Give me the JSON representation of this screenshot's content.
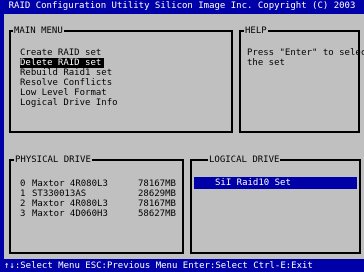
{
  "title": "RAID Configuration Utility   Silicon Image Inc. Copyright (C) 2003",
  "main_menu": {
    "title": "MAIN MENU",
    "items": [
      "Create RAID set",
      "Delete RAID set",
      "Rebuild Raid1 set",
      "Resolve Conflicts",
      "Low Level Format",
      "Logical Drive Info"
    ],
    "selected_index": 1
  },
  "help": {
    "title": "HELP",
    "line1": "Press \"Enter\" to select",
    "line2": "the set"
  },
  "physical_drive": {
    "title": "PHYSICAL DRIVE",
    "rows": [
      {
        "index": "0",
        "model": "Maxtor 4R080L3",
        "size": "78167MB"
      },
      {
        "index": "1",
        "model": "ST330013AS",
        "size": "28629MB"
      },
      {
        "index": "2",
        "model": "Maxtor 4R080L3",
        "size": "78167MB"
      },
      {
        "index": "3",
        "model": "Maxtor 4D060H3",
        "size": "58627MB"
      }
    ]
  },
  "logical_drive": {
    "title": "LOGICAL DRIVE",
    "items": [
      "SiI Raid10 Set"
    ],
    "selected_index": 0
  },
  "status_bar": "↑↓:Select Menu  ESC:Previous Menu  Enter:Select  Ctrl-E:Exit",
  "colors": {
    "background": "#0000a8",
    "panel": "#c0c0c0",
    "highlight": "#000000",
    "text_light": "#ffffff"
  }
}
